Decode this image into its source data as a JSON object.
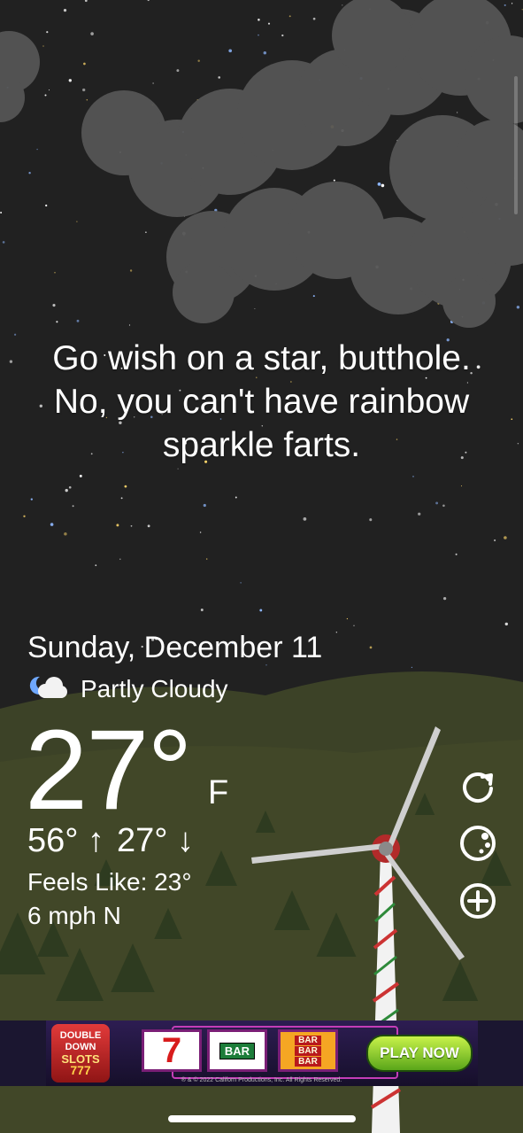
{
  "quote": {
    "line1": "Go wish on a star, butthole.",
    "line2": "No, you can't have rainbow",
    "line3": "sparkle farts."
  },
  "weather": {
    "date": "Sunday, December 11",
    "condition": "Partly Cloudy",
    "condition_icon": "partly-cloudy-night-icon",
    "temperature": "27°",
    "unit": "F",
    "high": "56°",
    "high_arrow": "↑",
    "low": "27°",
    "low_arrow": "↓",
    "feels_like": "Feels Like: 23°",
    "wind": "6 mph N"
  },
  "side_buttons": {
    "refresh_icon": "refresh-icon",
    "theme_icon": "moon-face-icon",
    "add_icon": "plus-circle-icon"
  },
  "ad": {
    "logo_line1": "DOUBLE",
    "logo_line2": "DOWN",
    "logo_line3": "SLOTS",
    "logo_line4": "777",
    "reel1": "7",
    "reel2": "BAR",
    "reel3a": "BAR",
    "reel3b": "BAR",
    "reel3c": "BAR",
    "cta": "PLAY NOW",
    "copyright": "® & © 2022 Californ Productions, Inc. All Rights Reserved."
  },
  "colors": {
    "sky": "#212121",
    "ground": "#3c4227",
    "cloud": "#555555",
    "text": "#ffffff"
  }
}
